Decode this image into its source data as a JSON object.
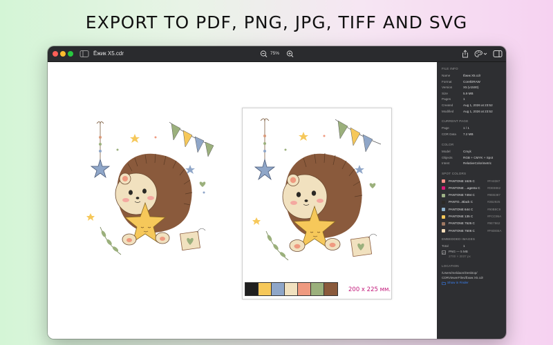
{
  "headline": "EXPORT TO PDF, PNG, JPG, TIFF AND SVG",
  "window": {
    "title": "Ёжик X5.cdr",
    "zoom": "75%"
  },
  "page": {
    "size_label": "200 x 225 мм.",
    "palette": [
      "#1f1f1f",
      "#f6c85a",
      "#8fa6c8",
      "#f1e1bf",
      "#ef9a80",
      "#9bb07c",
      "#8a5a3c"
    ]
  },
  "panel": {
    "file_info": {
      "heading": "FILE INFO",
      "rows": [
        {
          "k": "Name",
          "v": "Ёжик X5.cdr"
        },
        {
          "k": "Format",
          "v": "CorelDRAW"
        },
        {
          "k": "Version",
          "v": "X5 (v1500)"
        },
        {
          "k": "Size",
          "v": "5.9 MB"
        },
        {
          "k": "Pages",
          "v": "1"
        },
        {
          "k": "Created",
          "v": "Aug 1, 2026 at 23:52"
        },
        {
          "k": "Modified",
          "v": "Aug 1, 2026 at 23:52"
        }
      ]
    },
    "current_page": {
      "heading": "CURRENT PAGE",
      "rows": [
        {
          "k": "Page",
          "v": "1 / 1"
        },
        {
          "k": "CDR Data",
          "v": "7.2 MB"
        }
      ]
    },
    "color": {
      "heading": "COLOR",
      "rows": [
        {
          "k": "Model",
          "v": "Cmyk"
        },
        {
          "k": "Objects",
          "v": "RGB + CMYK + Spot"
        },
        {
          "k": "Intent",
          "v": "RelativeColorimetric"
        }
      ]
    },
    "spot_colors": {
      "heading": "SPOT COLORS",
      "items": [
        {
          "name": "PANTONE 1625 C",
          "hex": "#FA8387",
          "color": "#f48f86"
        },
        {
          "name": "PANTONE ...agenta C",
          "hex": "#DE8862",
          "color": "#d81b78"
        },
        {
          "name": "PANTONE 7494 C",
          "hex": "#9EB387",
          "color": "#9eb387"
        },
        {
          "name": "PANTO...Black C",
          "hex": "#2B2925",
          "color": "#2b2925"
        },
        {
          "name": "PANTONE 644 C",
          "hex": "#90B8C9",
          "color": "#90b3cd"
        },
        {
          "name": "PANTONE 135 C",
          "hex": "#FCC95A",
          "color": "#fcc95a"
        },
        {
          "name": "PANTONE 7525 C",
          "hex": "#9E7862",
          "color": "#9e7862"
        },
        {
          "name": "PANTONE 7506 C",
          "hex": "#F6DEBA",
          "color": "#f3dcb8"
        }
      ]
    },
    "embedded_images": {
      "heading": "EMBEDDED IMAGES",
      "total_label": "Total",
      "total_value": "1",
      "image_line": "PNG — 5 MB",
      "image_sub": "2700 × 3037 px"
    },
    "location": {
      "heading": "LOCATION",
      "path": "/Users/meldaon/Desktop/ CDRViewerFiles/Ёжик X5.cdr",
      "path_line1": "/Users/meldaon/Desktop/",
      "path_line2": "CDRViewerFiles/Ёжик X5.cdr",
      "link": "Show in Finder"
    }
  }
}
